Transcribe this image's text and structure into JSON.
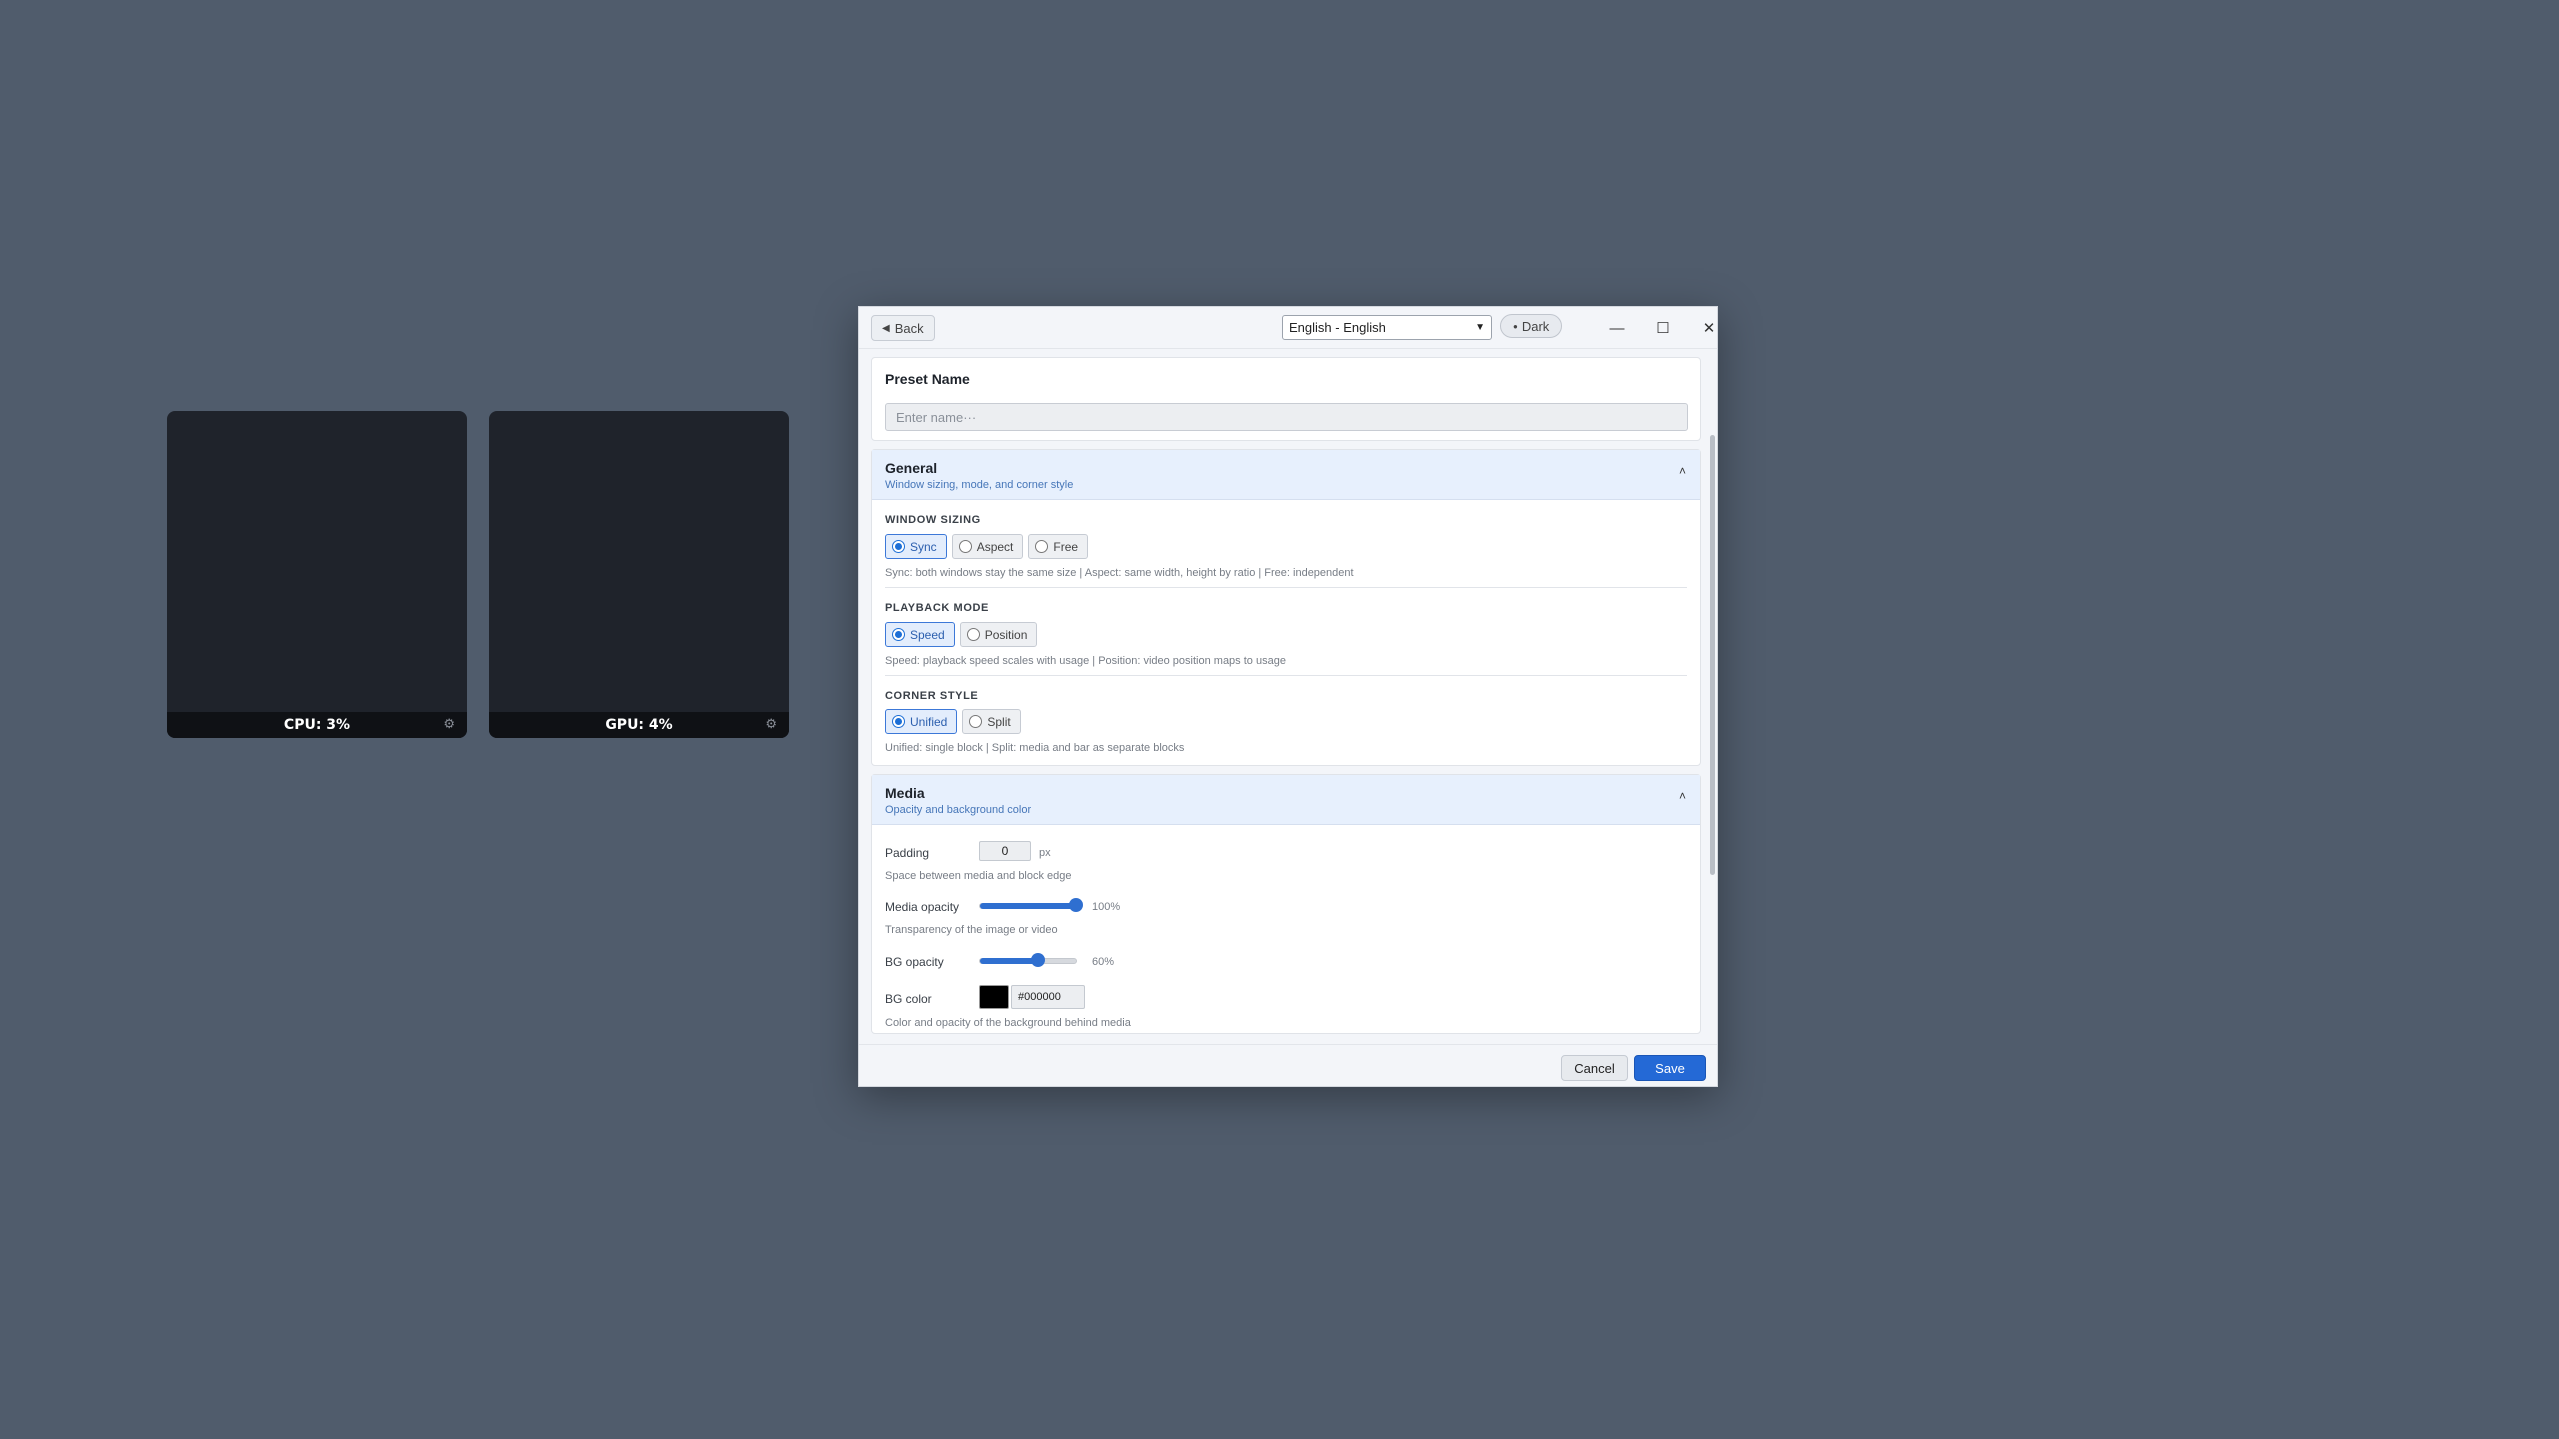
{
  "widgets": [
    {
      "label": "CPU: 3%",
      "icon": "gear-icon"
    },
    {
      "label": "GPU: 4%",
      "icon": "gear-icon"
    }
  ],
  "titlebar": {
    "back_label": "Back",
    "back_icon": "◀",
    "language_selected": "English - English",
    "theme_label": "Dark",
    "theme_icon": "●",
    "minimize_icon": "—",
    "maximize_icon": "☐",
    "close_icon": "✕"
  },
  "preset": {
    "title": "Preset Name",
    "placeholder": "Enter name···"
  },
  "general": {
    "title": "General",
    "subtitle": "Window sizing, mode, and corner style",
    "toggle_icon": "˄",
    "window_sizing": {
      "label": "WINDOW SIZING",
      "options": [
        "Sync",
        "Aspect",
        "Free"
      ],
      "selected": "Sync",
      "hint": "Sync: both windows stay the same size | Aspect: same width, height by ratio | Free: independent"
    },
    "playback_mode": {
      "label": "PLAYBACK MODE",
      "options": [
        "Speed",
        "Position"
      ],
      "selected": "Speed",
      "hint": "Speed: playback speed scales with usage | Position: video position maps to usage"
    },
    "corner_style": {
      "label": "CORNER STYLE",
      "options": [
        "Unified",
        "Split"
      ],
      "selected": "Unified",
      "hint": "Unified: single block | Split: media and bar as separate blocks"
    }
  },
  "media": {
    "title": "Media",
    "subtitle": "Opacity and background color",
    "toggle_icon": "˄",
    "padding": {
      "label": "Padding",
      "value": "0",
      "unit": "px",
      "hint": "Space between media and block edge"
    },
    "media_opacity": {
      "label": "Media opacity",
      "value": 100,
      "display": "100%",
      "hint": "Transparency of the image or video"
    },
    "bg_opacity": {
      "label": "BG opacity",
      "value": 60,
      "display": "60%"
    },
    "bg_color": {
      "label": "BG color",
      "value": "#000000",
      "hint": "Color and opacity of the background behind media"
    }
  },
  "footer": {
    "cancel_label": "Cancel",
    "save_label": "Save"
  },
  "colors": {
    "desktop": "#505c6c",
    "accent": "#2469d6",
    "widget": "#1f232b",
    "section_header": "#e7f0fd"
  }
}
